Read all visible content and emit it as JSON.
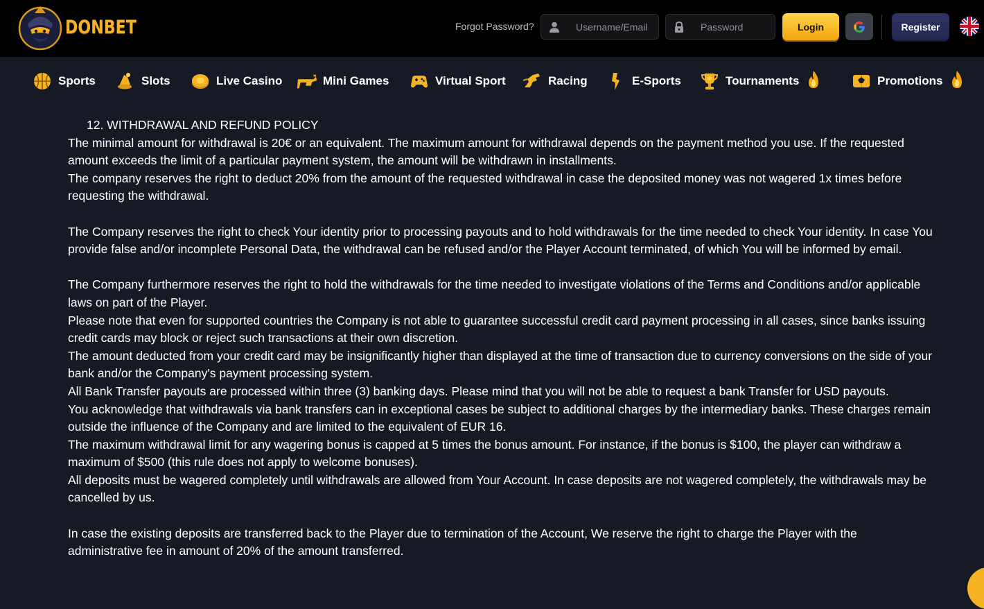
{
  "brand": {
    "name": "DONBET"
  },
  "header": {
    "forgot_label": "Forgot Password?",
    "username_placeholder": "Username/Email",
    "password_placeholder": "Password",
    "login_label": "Login",
    "register_label": "Register",
    "language": "en-GB"
  },
  "nav": {
    "items": [
      {
        "label": "Sports",
        "icon": "basketball-icon"
      },
      {
        "label": "Slots",
        "icon": "slots-icon"
      },
      {
        "label": "Live Casino",
        "icon": "chip-icon"
      },
      {
        "label": "Mini Games",
        "icon": "gun-icon"
      },
      {
        "label": "Virtual Sport",
        "icon": "gamepad-icon"
      },
      {
        "label": "Racing",
        "icon": "horse-icon"
      },
      {
        "label": "E-Sports",
        "icon": "esports-icon"
      },
      {
        "label": "Tournaments",
        "icon": "trophy-icon",
        "hot": true
      },
      {
        "label": "Promotions",
        "icon": "gift-icon",
        "hot": true
      }
    ]
  },
  "content": {
    "heading": "12. WITHDRAWAL AND REFUND POLICY",
    "paragraphs": [
      "The minimal amount for withdrawal is 20€ or an equivalent. The maximum amount for withdrawal depends on the payment method you use. If the requested amount exceeds the limit of a particular payment system, the amount will be withdrawn in installments.",
      "The company reserves the right to deduct 20% from the amount of the requested withdrawal in case the deposited money was not wagered 1x times before requesting the withdrawal.",
      "The Company reserves the right to check Your identity prior to processing payouts and to hold withdrawals for the time needed to check Your identity. In case You provide false and/or incomplete Personal Data, the withdrawal can be refused and/or the Player Account terminated, of which You will be informed by email.",
      "The Company furthermore reserves the right to hold the withdrawals for the time needed to investigate violations of the Terms and Conditions and/or applicable laws on part of the Player.",
      "Please note that even for supported countries the Company is not able to guarantee successful credit card payment processing in all cases, since banks issuing credit cards may block or reject such transactions at their own discretion.",
      "The amount deducted from your credit card may be insignificantly higher than displayed at the time of transaction due to currency conversions on the side of your bank and/or the Company's payment processing system.",
      "All Bank Transfer payouts are processed within three (3) banking days. Please mind that you will not be able to request a bank Transfer for USD payouts.",
      "You acknowledge that withdrawals via bank transfers can in exceptional cases be subject to additional charges by the intermediary banks. These charges remain outside the influence of the Company and are limited to the equivalent of EUR 16.",
      "The maximum withdrawal limit for any wagering bonus is capped at 5 times the bonus amount. For instance, if the bonus is $100, the player can withdraw a maximum of $500 (this rule does not apply to welcome bonuses).",
      "All deposits must be wagered completely until withdrawals are allowed from Your Account. In case deposits are not wagered completely, the withdrawals may be cancelled by us.",
      "In case the existing deposits are transferred back to the Player due to termination of the Account, We reserve the right to charge the Player with the administrative fee in amount of 20% of the amount transferred."
    ]
  },
  "colors": {
    "accent": "#f5b324",
    "background": "#161a25",
    "header": "#000000",
    "register": "#262d5a"
  }
}
